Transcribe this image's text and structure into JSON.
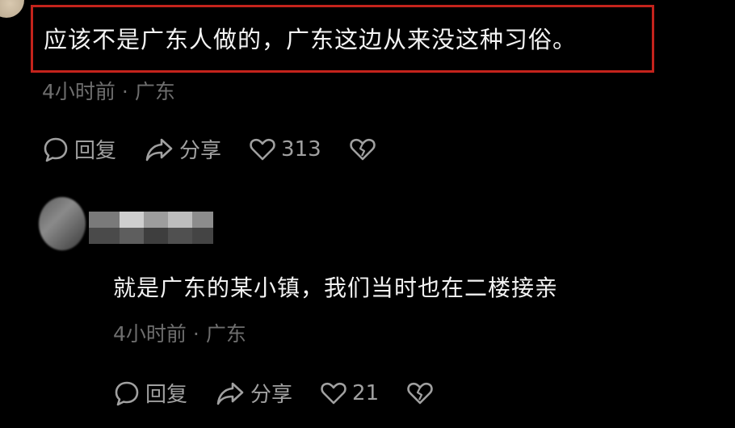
{
  "comment1": {
    "text": "应该不是广东人做的，广东这边从来没这种习俗。",
    "time": "4小时前",
    "sep": "·",
    "location": "广东",
    "reply_label": "回复",
    "share_label": "分享",
    "like_count": "313"
  },
  "comment2": {
    "text": "就是广东的某小镇，我们当时也在二楼接亲",
    "time": "4小时前",
    "sep": "·",
    "location": "广东",
    "reply_label": "回复",
    "share_label": "分享",
    "like_count": "21"
  },
  "colors": {
    "background": "#000000",
    "highlight_border": "#c4231c",
    "meta_text": "#6e6e6e",
    "action_text": "#a0a0a0"
  },
  "icons": [
    "comment-icon",
    "share-icon",
    "heart-icon",
    "broken-heart-icon"
  ]
}
